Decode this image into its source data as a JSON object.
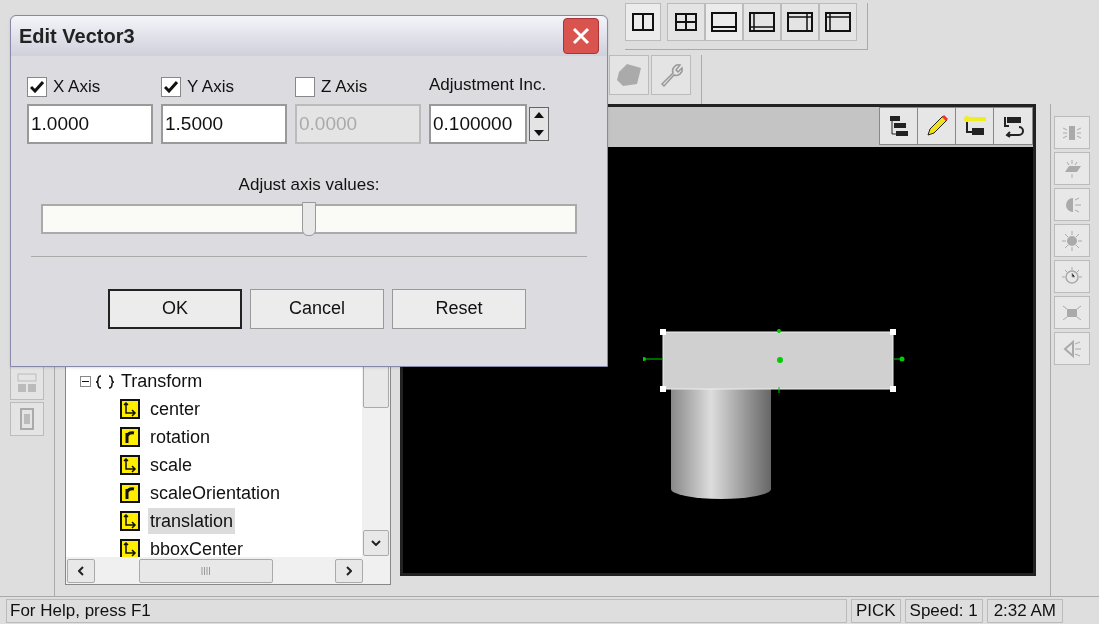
{
  "dialog": {
    "title": "Edit Vector3",
    "axes": [
      {
        "label": "X Axis",
        "checked": true,
        "value": "1.0000"
      },
      {
        "label": "Y Axis",
        "checked": true,
        "value": "1.5000"
      },
      {
        "label": "Z Axis",
        "checked": false,
        "value": "0.0000"
      }
    ],
    "increment": {
      "label": "Adjustment Inc.",
      "value": "0.100000"
    },
    "slider": {
      "label": "Adjust axis values:",
      "level": 0.5
    },
    "buttons": [
      {
        "label": "OK",
        "default": true
      },
      {
        "label": "Cancel",
        "default": false
      },
      {
        "label": "Reset",
        "default": false
      }
    ]
  },
  "tree": {
    "label": "Transform",
    "expanded": true,
    "children": [
      {
        "label": "center",
        "kind": "vector",
        "selected": false
      },
      {
        "label": "rotation",
        "kind": "rotation",
        "selected": false
      },
      {
        "label": "scale",
        "kind": "vector",
        "selected": false
      },
      {
        "label": "scaleOrientation",
        "kind": "rotation",
        "selected": false
      },
      {
        "label": "translation",
        "kind": "vector",
        "selected": true
      },
      {
        "label": "bboxCenter",
        "kind": "vector",
        "selected": false
      }
    ]
  },
  "status_bar": {
    "help": "For Help, press F1",
    "mode": "PICK",
    "speed": "Speed: 1",
    "time": "2:32 AM"
  }
}
